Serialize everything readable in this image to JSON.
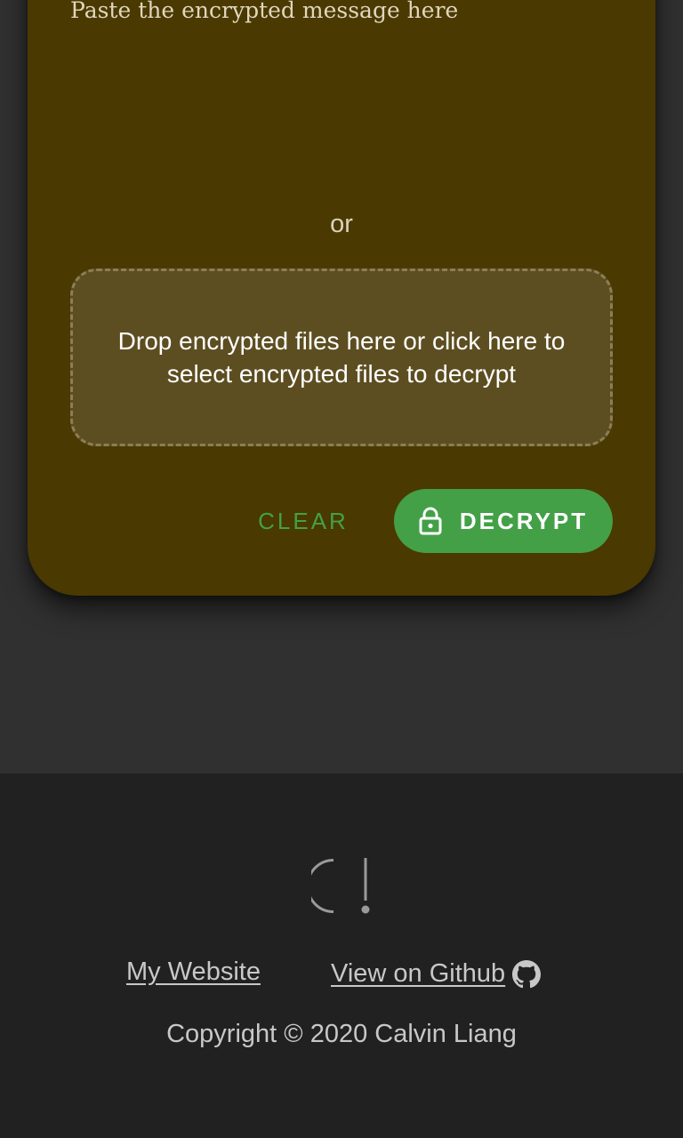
{
  "decrypt_card": {
    "message_placeholder": "Paste the encrypted message here",
    "message_value": "",
    "or_text": "or",
    "dropzone_text": "Drop encrypted files here or click here to select encrypted files to decrypt",
    "clear_label": "CLEAR",
    "decrypt_label": "DECRYPT",
    "decrypt_icon": "lock-icon"
  },
  "footer": {
    "logo_icon": "logo-icon",
    "website_link": "My Website",
    "github_link": "View on Github",
    "github_icon": "github-icon",
    "copyright": "Copyright © 2020 Calvin Liang"
  },
  "colors": {
    "page_background": "#303030",
    "card_background": "#4a3900",
    "dropzone_background": "#5d4e21",
    "accent_green": "#43a047",
    "footer_background": "#212121"
  }
}
